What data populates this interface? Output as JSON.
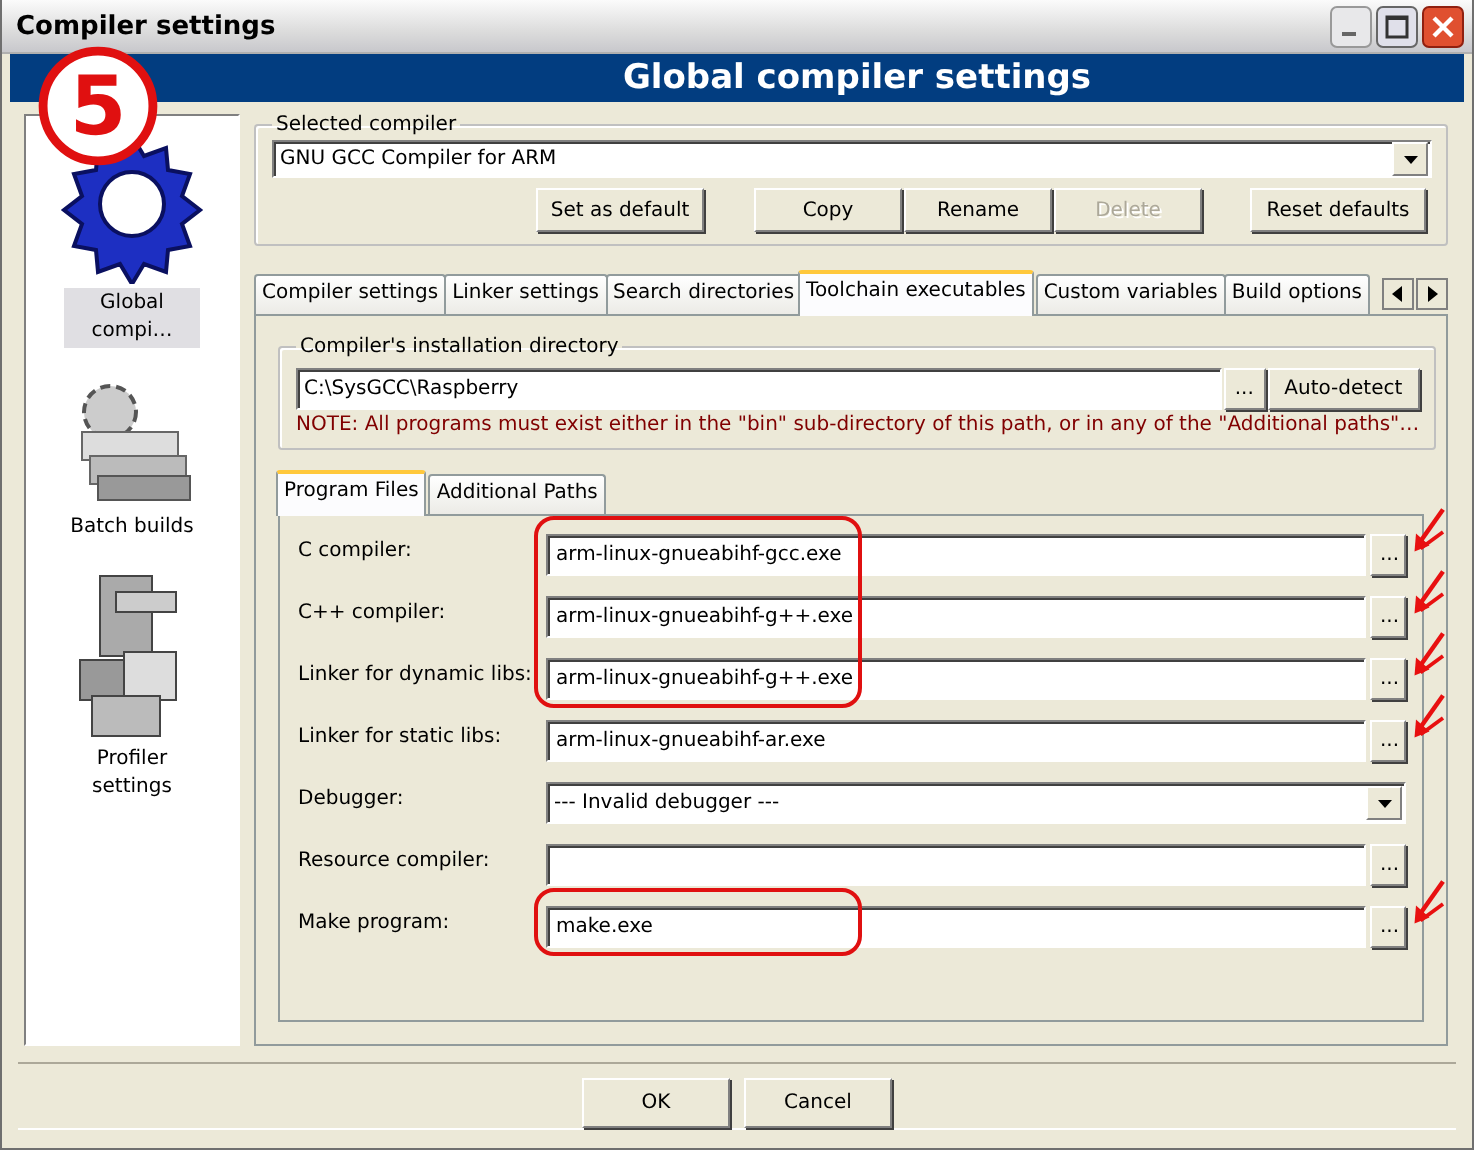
{
  "window": {
    "title": "Compiler settings"
  },
  "annotation_badge": "5",
  "header": "Global compiler settings",
  "sidebar": {
    "items": [
      {
        "label": "Global compi…",
        "selected": true
      },
      {
        "label": "Batch builds",
        "selected": false
      },
      {
        "label": "Profiler settings",
        "selected": false
      }
    ]
  },
  "selected_compiler": {
    "legend": "Selected compiler",
    "value": "GNU GCC Compiler for ARM",
    "buttons": [
      {
        "label": "Set as default",
        "disabled": false
      },
      {
        "label": "Copy",
        "disabled": false
      },
      {
        "label": "Rename",
        "disabled": false
      },
      {
        "label": "Delete",
        "disabled": true
      },
      {
        "label": "Reset defaults",
        "disabled": false
      }
    ]
  },
  "tabs": [
    {
      "label": "Compiler settings",
      "selected": false
    },
    {
      "label": "Linker settings",
      "selected": false
    },
    {
      "label": "Search directories",
      "selected": false
    },
    {
      "label": "Toolchain executables",
      "selected": true
    },
    {
      "label": "Custom variables",
      "selected": false
    },
    {
      "label": "Build options",
      "selected": false
    }
  ],
  "install_dir": {
    "legend": "Compiler's installation directory",
    "value": "C:\\SysGCC\\Raspberry",
    "browse": "...",
    "detect": "Auto-detect",
    "note": "NOTE: All programs must exist either in the \"bin\" sub-directory of this path, or in any of the \"Additional paths\"…"
  },
  "sub_tabs": [
    {
      "label": "Program Files",
      "selected": true
    },
    {
      "label": "Additional Paths",
      "selected": false
    }
  ],
  "programs": [
    {
      "label": "C compiler:",
      "kind": "file",
      "value": "arm-linux-gnueabihf-gcc.exe",
      "button": "...",
      "circled": true,
      "arrow": true
    },
    {
      "label": "C++ compiler:",
      "kind": "file",
      "value": "arm-linux-gnueabihf-g++.exe",
      "button": "...",
      "circled": true,
      "arrow": true
    },
    {
      "label": "Linker for dynamic libs:",
      "kind": "file",
      "value": "arm-linux-gnueabihf-g++.exe",
      "button": "...",
      "circled": true,
      "arrow": true
    },
    {
      "label": "Linker for static libs:",
      "kind": "file",
      "value": "arm-linux-gnueabihf-ar.exe",
      "button": "...",
      "circled": false,
      "arrow": true
    },
    {
      "label": "Debugger:",
      "kind": "dropdown",
      "value": "--- Invalid debugger ---",
      "circled": false,
      "arrow": false
    },
    {
      "label": "Resource compiler:",
      "kind": "file",
      "button": "...",
      "circled": false,
      "arrow": false
    },
    {
      "label": "Make program:",
      "kind": "file",
      "value": "make.exe",
      "button": "...",
      "circled": true,
      "arrow": true
    }
  ],
  "dialog_buttons": [
    "OK",
    "Cancel"
  ]
}
